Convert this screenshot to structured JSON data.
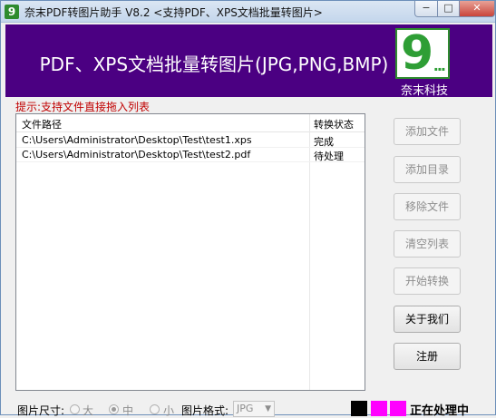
{
  "window": {
    "title": "奈末PDF转图片助手 V8.2    <支持PDF、XPS文档批量转图片>",
    "app_icon": "9",
    "minimize_glyph": "−",
    "maximize_glyph": "□",
    "close_glyph": "✕"
  },
  "banner": {
    "title": "PDF、XPS文档批量转图片(JPG,PNG,BMP)",
    "logo_mark": "9",
    "logo_dots": "...",
    "logo_text": "奈末科技",
    "background": "#4b0082"
  },
  "hint": "提示:支持文件直接拖入列表",
  "file_list": {
    "columns": [
      "文件路径",
      "转换状态"
    ],
    "rows": [
      {
        "path": "C:\\Users\\Administrator\\Desktop\\Test\\test1.xps",
        "status": "完成"
      },
      {
        "path": "C:\\Users\\Administrator\\Desktop\\Test\\test2.pdf",
        "status": "待处理"
      }
    ]
  },
  "buttons": {
    "add_file": "添加文件",
    "add_dir": "添加目录",
    "remove_file": "移除文件",
    "clear_list": "清空列表",
    "start": "开始转换",
    "about": "关于我们",
    "register": "注册"
  },
  "options": {
    "size_label": "图片尺寸:",
    "size_options": [
      "大",
      "中",
      "小"
    ],
    "size_selected": "中",
    "format_label": "图片格式:",
    "format_value": "JPG"
  },
  "status": {
    "text": "正在处理中",
    "swatch_colors": [
      "#000000",
      "#ff00ff",
      "#ff00ff"
    ]
  }
}
